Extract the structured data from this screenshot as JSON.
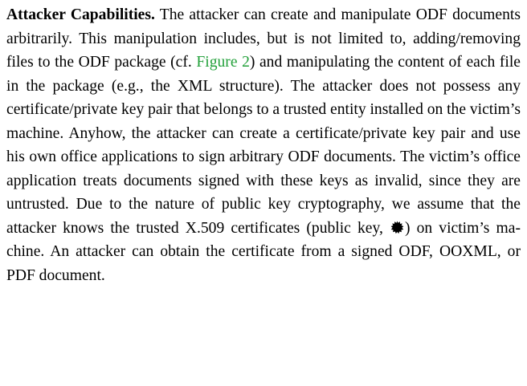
{
  "paragraph": {
    "heading": "Attacker Capabilities.",
    "text_1": " The attacker can create and manipu­late ODF documents arbitrarily. This manipulation includes, but is not limited to, adding/removing files to the ODF pack­age (cf. ",
    "figure_link": "Figure 2",
    "text_2": ") and manipulating the content of each file in the package (e.g., the XML structure). The attacker does not possess any certificate/private key pair that belongs to a trusted entity installed on the victim’s machine. Anyhow, the attacker can create a certificate/private key pair and use his own office applications to sign arbitrary ODF documents. The victim’s office application treats documents signed with these keys as invalid, since they are untrusted. Due to the nature of public key cryptography, we assume that the attacker knows the trusted X.509 certificates (public key, ",
    "key_icon": "public-key-icon",
    "text_3": ") on victim’s ma­chine. An attacker can obtain the certificate from a signed ODF, OOXML, or PDF document."
  },
  "colors": {
    "link": "#22a03a",
    "text": "#000000"
  }
}
